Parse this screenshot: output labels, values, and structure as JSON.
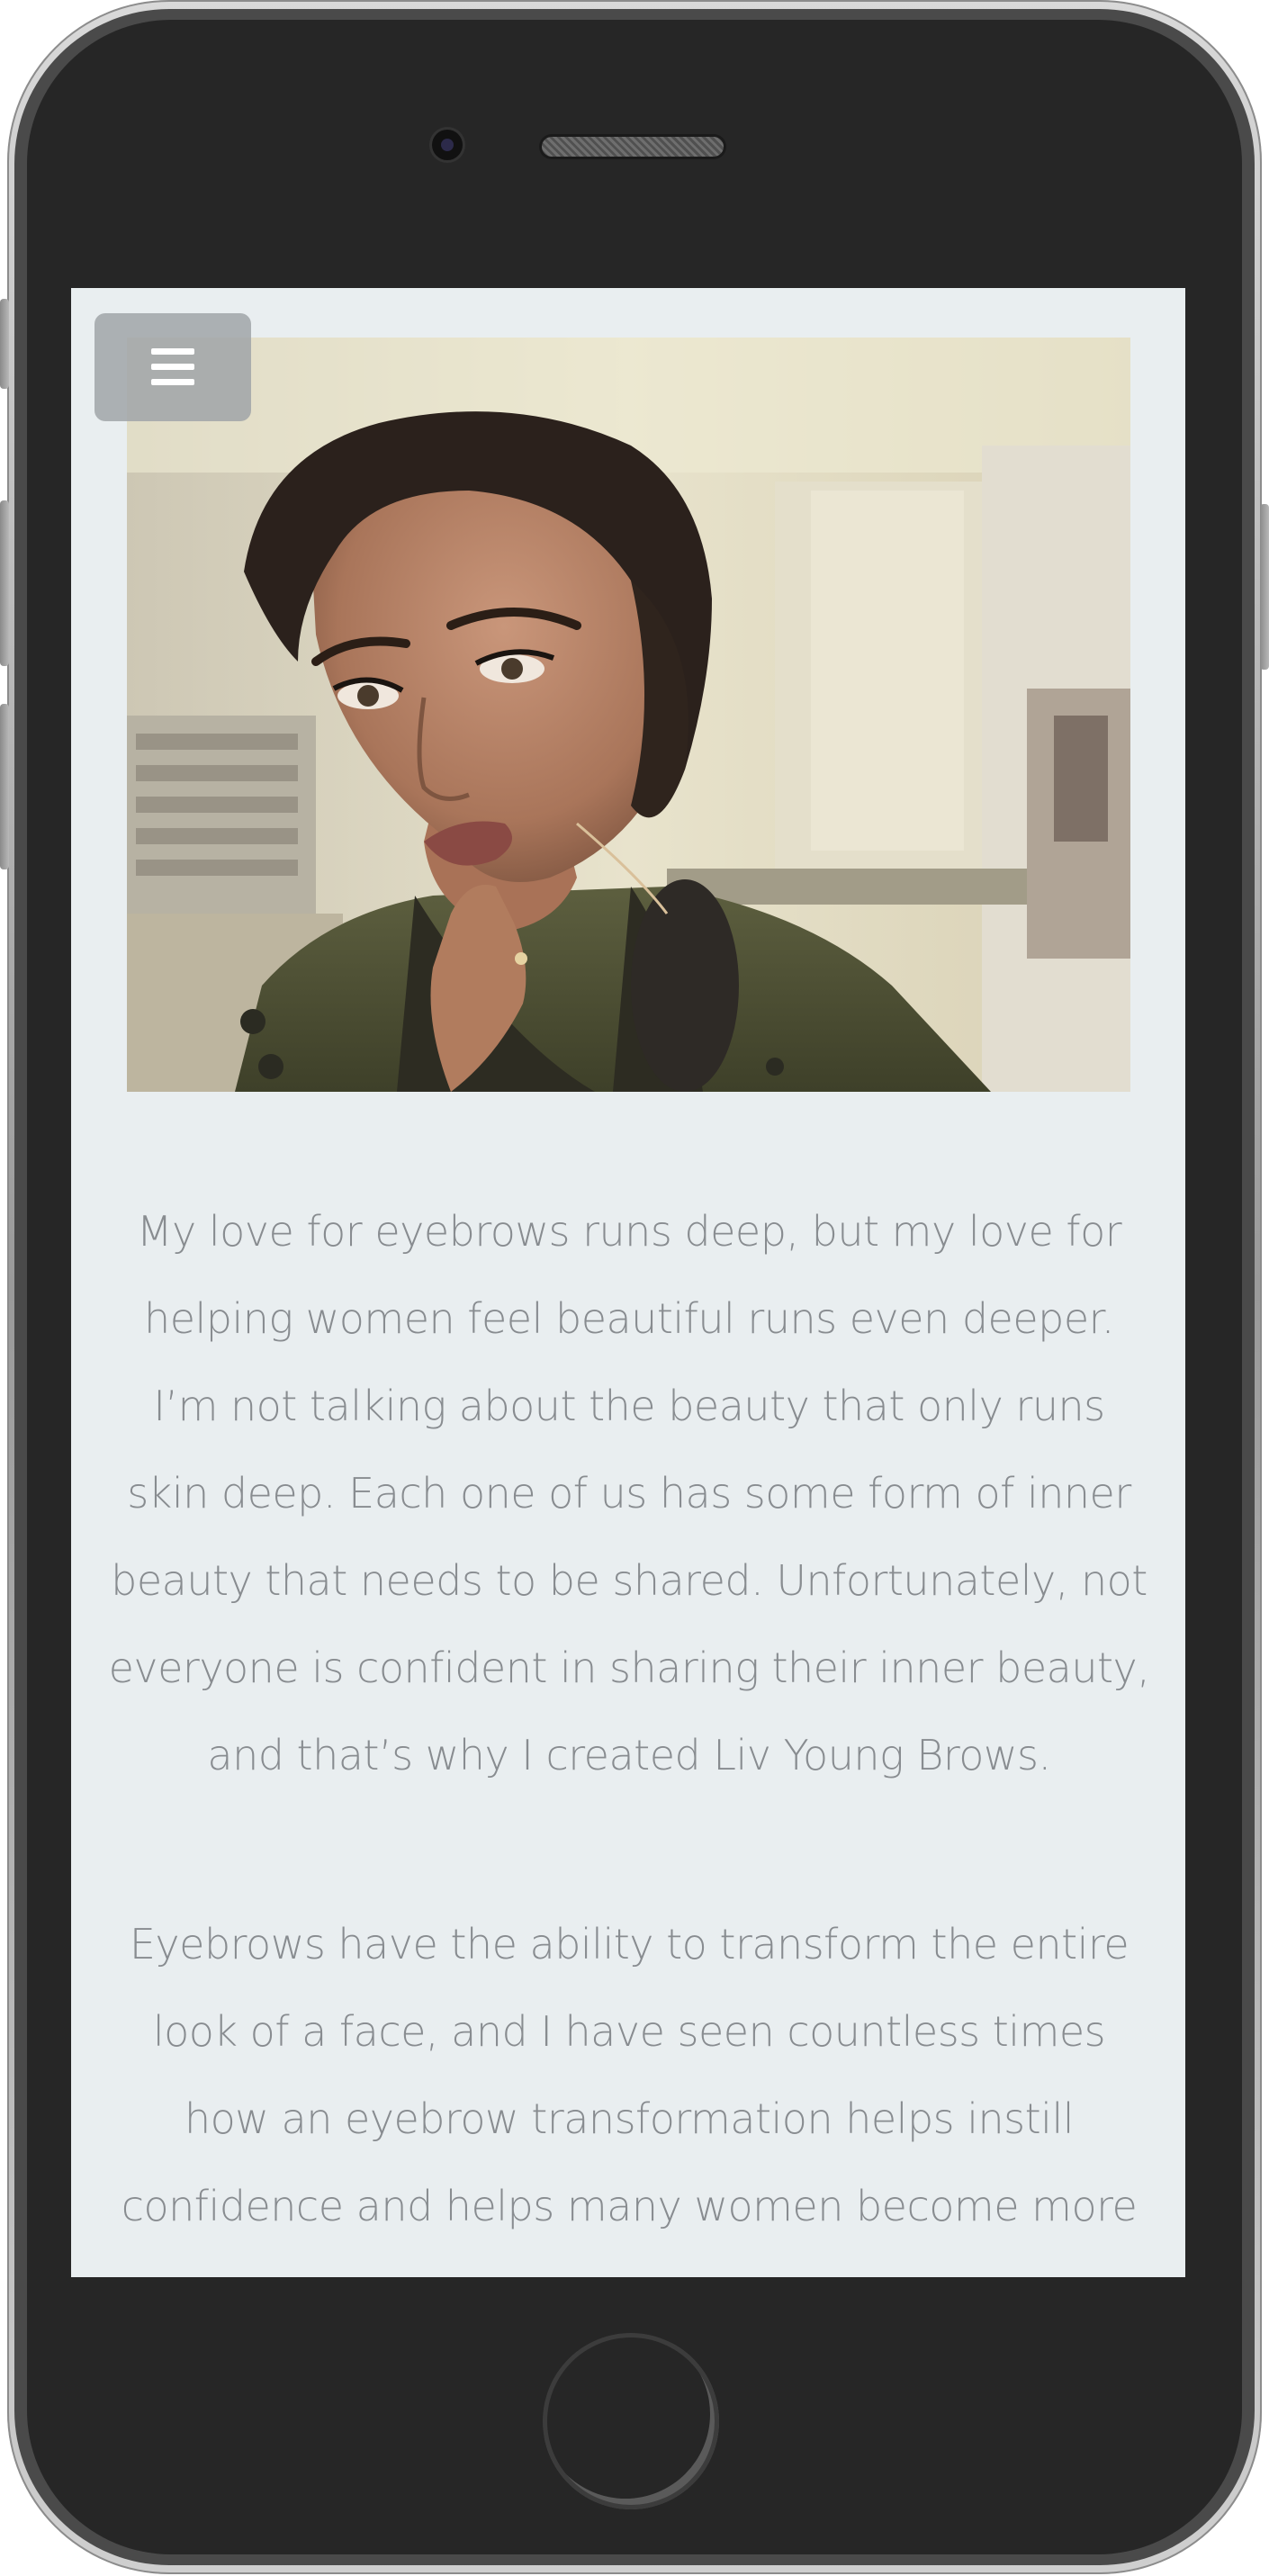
{
  "device": {
    "model": "smartphone",
    "frame_color": "#262626",
    "screen_background": "#e9eef0",
    "text_color": "#888c90"
  },
  "header": {
    "menu_icon": "hamburger-menu-icon"
  },
  "hero": {
    "image_description": "woman-portrait-photo"
  },
  "article": {
    "paragraphs": [
      "My love for eyebrows runs deep, but my love for helping women feel beautiful runs even deeper. I’m not talking about the beauty that only runs skin deep. Each one of us has some form of inner beauty that needs to be shared. Unfortunately, not everyone is confident in sharing their inner beauty, and that’s why I created Liv Young Brows.",
      "Eyebrows have the ability to transform the entire look of a face, and I have seen countless times how an eyebrow transformation helps instill confidence and helps many women become more"
    ]
  }
}
